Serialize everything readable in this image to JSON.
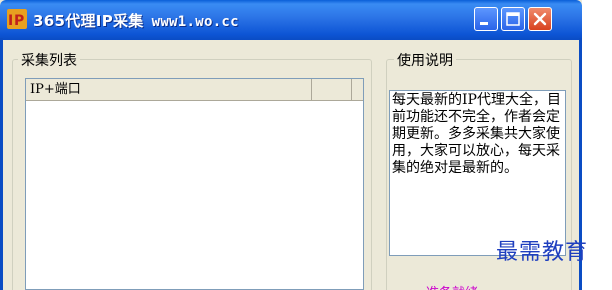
{
  "window": {
    "title": "365代理IP采集",
    "url": "www1.wo.cc",
    "icon": "ip-logo-icon",
    "controls": [
      "minimize-icon",
      "maximize-icon",
      "close-icon"
    ]
  },
  "collect_list": {
    "caption": "采集列表",
    "columns": [
      "IP+端口",
      ""
    ],
    "rows": []
  },
  "usage": {
    "caption": "使用说明",
    "text": "每天最新的IP代理大全，目前功能还不完全，作者会定期更新。多多采集共大家使用，大家可以放心，每天采集的绝对是最新的。"
  },
  "watermark": "最需教育",
  "status_text": "准备就绪"
}
